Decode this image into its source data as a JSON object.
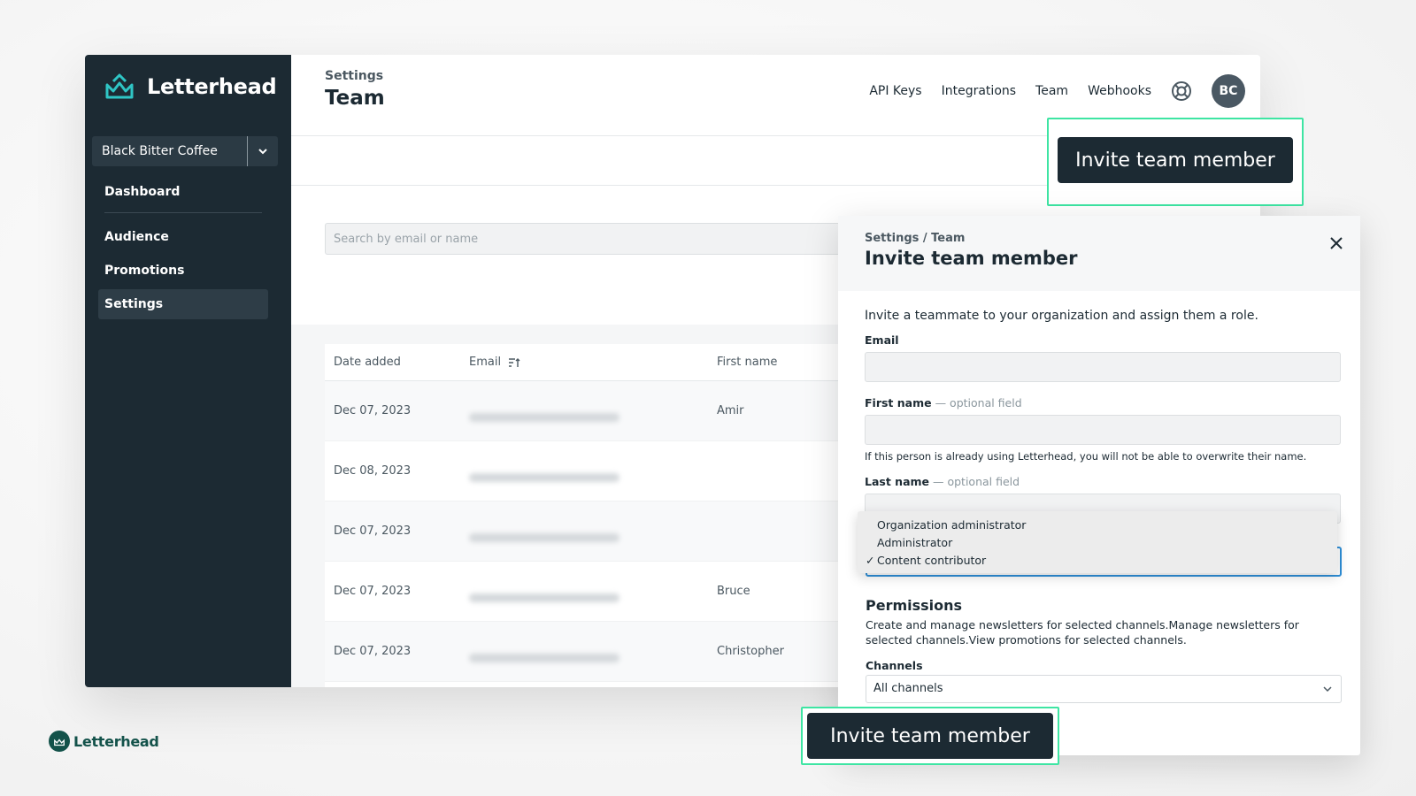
{
  "brand": {
    "name": "Letterhead",
    "accent": "#2fc5c5",
    "footer_name": "Letterhead"
  },
  "sidebar": {
    "org_name": "Black Bitter Coffee",
    "items": [
      {
        "label": "Dashboard"
      },
      {
        "label": "Audience"
      },
      {
        "label": "Promotions"
      },
      {
        "label": "Settings",
        "active": true
      }
    ]
  },
  "header": {
    "breadcrumb": "Settings",
    "title": "Team",
    "nav": [
      "API Keys",
      "Integrations",
      "Team",
      "Webhooks"
    ],
    "avatar_initials": "BC"
  },
  "search": {
    "placeholder": "Search by email or name"
  },
  "table": {
    "columns": [
      "Date added",
      "Email",
      "First name"
    ],
    "rows": [
      {
        "date": "Dec 07, 2023",
        "first_name": "Amir"
      },
      {
        "date": "Dec 08, 2023",
        "first_name": ""
      },
      {
        "date": "Dec 07, 2023",
        "first_name": ""
      },
      {
        "date": "Dec 07, 2023",
        "first_name": "Bruce"
      },
      {
        "date": "Dec 07, 2023",
        "first_name": "Christopher"
      }
    ]
  },
  "invite_button_label": "Invite team member",
  "modal": {
    "breadcrumb": "Settings / Team",
    "title": "Invite team member",
    "intro": "Invite a teammate to your organization and assign them a role.",
    "email_label": "Email",
    "first_name_label": "First name",
    "last_name_label": "Last name",
    "optional_suffix": " — optional field",
    "help_text": "If this person is already using Letterhead, you will not be able to overwrite their name.",
    "role_options": [
      "Organization administrator",
      "Administrator",
      "Content contributor"
    ],
    "selected_role": "Content contributor",
    "check_mark": "✓",
    "permissions_title": "Permissions",
    "permissions_text": "Create and manage newsletters for selected channels.Manage newsletters for selected channels.View promotions for selected channels.",
    "channels_label": "Channels",
    "channels_value": "All channels"
  },
  "colors": {
    "sidebar_bg": "#1c2a33",
    "callout_border": "#3ee5a3",
    "button_bg": "#1c2a33"
  }
}
